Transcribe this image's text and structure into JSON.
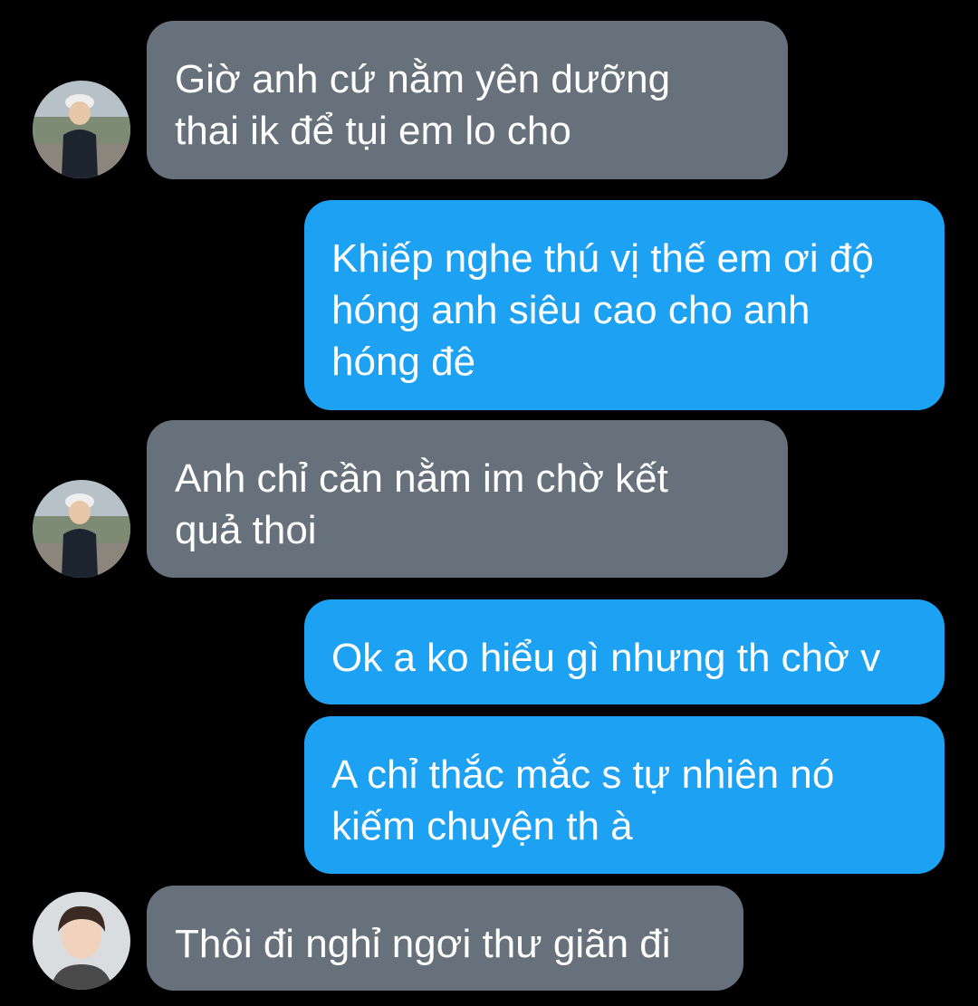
{
  "colors": {
    "background": "#000000",
    "incoming_bubble": "#67717c",
    "outgoing_bubble": "#1da1f2",
    "text": "#ffffff"
  },
  "messages": [
    {
      "direction": "incoming",
      "avatar": "child-photo-avatar",
      "text": "Giờ anh cứ nằm yên dưỡng\nthai ik để tụi em lo cho"
    },
    {
      "direction": "outgoing",
      "text": "Khiếp nghe thú vị thế em ơi độ\nhóng anh siêu cao cho anh\nhóng đê"
    },
    {
      "direction": "incoming",
      "avatar": "child-photo-avatar",
      "text": "Anh chỉ cần nằm im chờ kết\nquả thoi"
    },
    {
      "direction": "outgoing",
      "text": "Ok a ko hiểu gì nhưng th chờ v"
    },
    {
      "direction": "outgoing",
      "text": "A chỉ thắc mắc s tự nhiên nó\nkiếm chuyện th à"
    },
    {
      "direction": "incoming",
      "avatar": "young-man-photo-avatar",
      "text": "Thôi đi nghỉ ngơi thư giãn đi"
    }
  ]
}
